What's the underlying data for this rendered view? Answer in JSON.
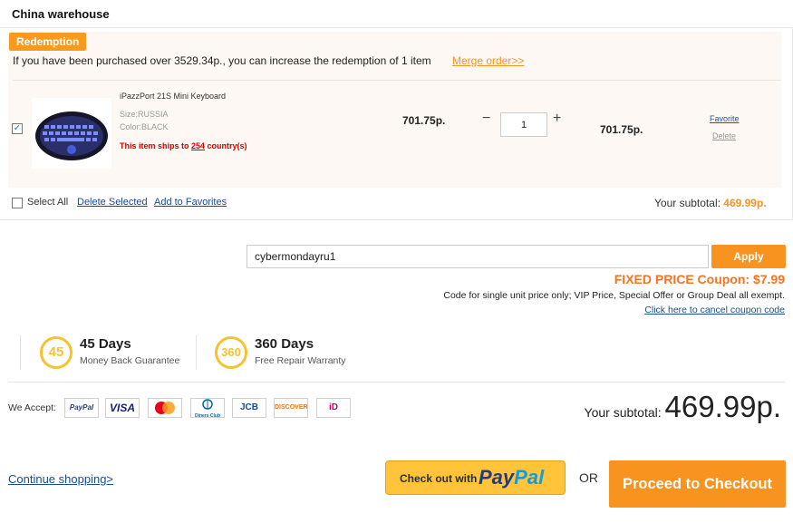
{
  "warehouse": {
    "title": "China warehouse"
  },
  "redemption": {
    "badge": "Redemption",
    "message": "If you have been purchased over 3529.34p., you can increase the redemption of 1 item",
    "merge_link": "Merge order>>"
  },
  "item": {
    "checked": true,
    "name": "iPazzPort 21S Mini Keyboard",
    "size": "Size:RUSSIA",
    "color": "Color:BLACK",
    "ships_prefix": "This item ships to ",
    "ships_count": "254",
    "ships_suffix": " country(s)",
    "unit_price": "701.75p.",
    "quantity": "1",
    "qty_minus": "−",
    "qty_plus": "+",
    "line_total": "701.75p.",
    "favorite": "Favorite",
    "delete": "Delete"
  },
  "panel": {
    "select_all": "Select All",
    "delete_selected": "Delete Selected",
    "add_to_favorites": "Add to Favorites",
    "subtotal_label": "Your subtotal: ",
    "subtotal_value": "469.99p."
  },
  "coupon": {
    "code": "cybermondayru1",
    "apply": "Apply",
    "fixed_price": "FIXED PRICE Coupon: $7.99",
    "note": "Code for single unit price only; VIP Price, Special Offer or Group Deal all exempt.",
    "cancel_link": "Click here to cancel coupon code"
  },
  "guarantees": [
    {
      "badge": "45",
      "title": "45 Days",
      "subtitle": "Money Back Guarantee"
    },
    {
      "badge": "360",
      "title": "360 Days",
      "subtitle": "Free Repair Warranty"
    }
  ],
  "payment": {
    "we_accept": "We Accept:",
    "cards": [
      {
        "icon": "paypal-card-icon",
        "label": "PayPal"
      },
      {
        "icon": "visa-card-icon",
        "label": "VISA"
      },
      {
        "icon": "mastercard-card-icon",
        "label": ""
      },
      {
        "icon": "diners-club-card-icon",
        "label": "Diners Club"
      },
      {
        "icon": "jcb-card-icon",
        "label": "JCB"
      },
      {
        "icon": "discover-card-icon",
        "label": "DISCOVER"
      },
      {
        "icon": "ideal-card-icon",
        "label": "iD"
      }
    ]
  },
  "summary": {
    "subtotal_label": "Your subtotal: ",
    "subtotal_value": "469.99p."
  },
  "actions": {
    "continue_shopping": "Continue shopping>",
    "paypal_prefix": "Check out with",
    "paypal_pay": "Pay",
    "paypal_pal": "Pal",
    "or": "OR",
    "proceed": "Proceed to Checkout"
  },
  "colors": {
    "accent": "#f7931e",
    "badge_gold": "#f7c131",
    "link_blue": "#1a4d8f",
    "alert_red": "#d40000",
    "paypal_yellow": "#ffc439"
  }
}
